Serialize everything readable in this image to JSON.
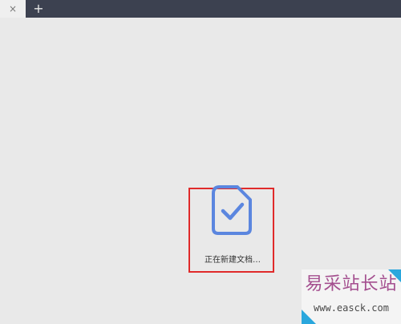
{
  "tabs": {
    "close_icon": "×",
    "new_tab_icon": "+"
  },
  "status": {
    "text": "正在新建文档…",
    "icon": "document-check-icon",
    "icon_color": "#5b86df",
    "highlight_color": "#e02a2a"
  },
  "watermark": {
    "title": "易采站长站",
    "url": "www.easck.com"
  },
  "colors": {
    "tabbar": "#3c4150",
    "background": "#e9e9e9",
    "watermark_accent": "#2aa7dd"
  }
}
